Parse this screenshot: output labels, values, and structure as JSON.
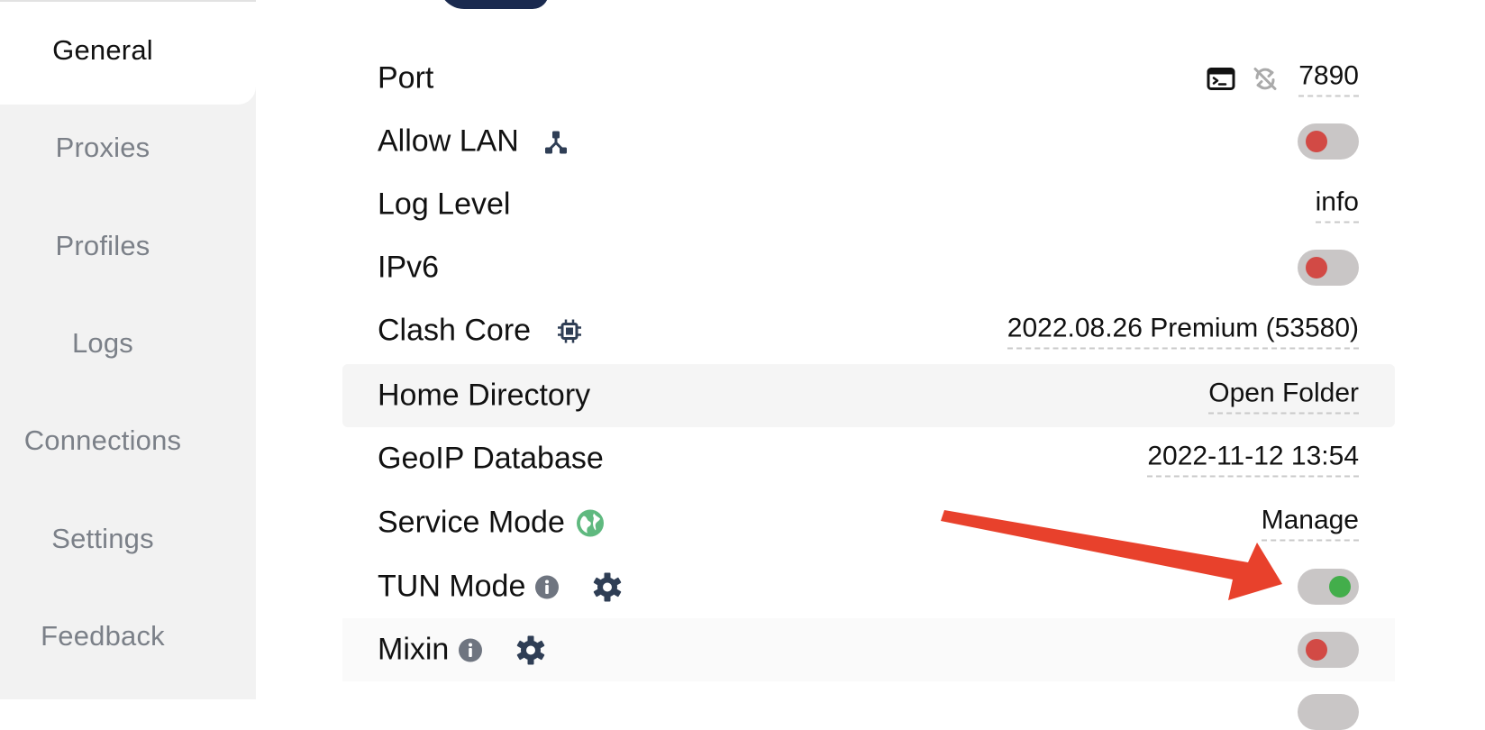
{
  "sidebar": {
    "items": [
      {
        "label": "General",
        "active": true
      },
      {
        "label": "Proxies",
        "active": false
      },
      {
        "label": "Profiles",
        "active": false
      },
      {
        "label": "Logs",
        "active": false
      },
      {
        "label": "Connections",
        "active": false
      },
      {
        "label": "Settings",
        "active": false
      },
      {
        "label": "Feedback",
        "active": false
      }
    ]
  },
  "settings": {
    "port": {
      "label": "Port",
      "value": "7890",
      "icons": [
        "terminal-icon",
        "random-port-icon"
      ]
    },
    "allow_lan": {
      "label": "Allow LAN",
      "icon": "network-icon",
      "enabled": false
    },
    "log_level": {
      "label": "Log Level",
      "value": "info"
    },
    "ipv6": {
      "label": "IPv6",
      "enabled": false
    },
    "clash_core": {
      "label": "Clash Core",
      "icon": "chip-icon",
      "value": "2022.08.26 Premium (53580)"
    },
    "home_directory": {
      "label": "Home Directory",
      "value": "Open Folder"
    },
    "geoip_database": {
      "label": "GeoIP Database",
      "value": "2022-11-12 13:54"
    },
    "service_mode": {
      "label": "Service Mode",
      "icon": "globe-icon",
      "value": "Manage"
    },
    "tun_mode": {
      "label": "TUN Mode",
      "icons": [
        "info-icon",
        "gear-icon"
      ],
      "enabled": true
    },
    "mixin": {
      "label": "Mixin",
      "icons": [
        "info-icon",
        "gear-icon"
      ],
      "enabled": false
    }
  },
  "colors": {
    "toggle_off_knob": "#d24a45",
    "toggle_on_knob": "#43ae4b",
    "annotation_arrow": "#e8412c",
    "service_mode_icon": "#5fb97f"
  }
}
